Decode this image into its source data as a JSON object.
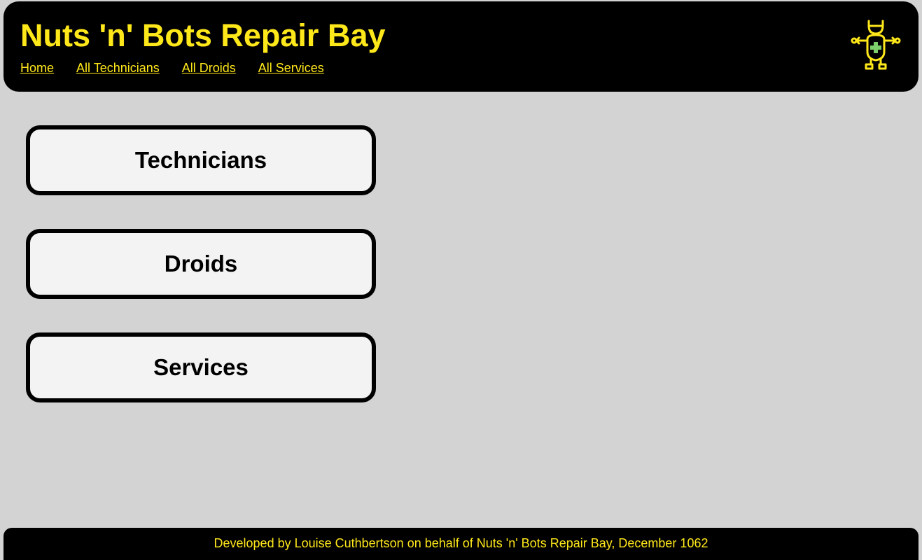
{
  "header": {
    "title": "Nuts 'n' Bots Repair Bay",
    "logo_icon": "robot-medic-icon",
    "nav": [
      {
        "label": "Home"
      },
      {
        "label": "All Technicians"
      },
      {
        "label": "All Droids"
      },
      {
        "label": "All Services"
      }
    ]
  },
  "main": {
    "cards": [
      {
        "label": "Technicians"
      },
      {
        "label": "Droids"
      },
      {
        "label": "Services"
      }
    ]
  },
  "footer": {
    "text": "Developed by Louise Cuthbertson on behalf of Nuts 'n' Bots Repair Bay, December 1062"
  },
  "colors": {
    "accent": "#ffe81a",
    "header_bg": "#000000",
    "page_bg": "#d3d3d3",
    "card_bg": "#f3f3f3",
    "logo_cross": "#7ccf6a"
  }
}
